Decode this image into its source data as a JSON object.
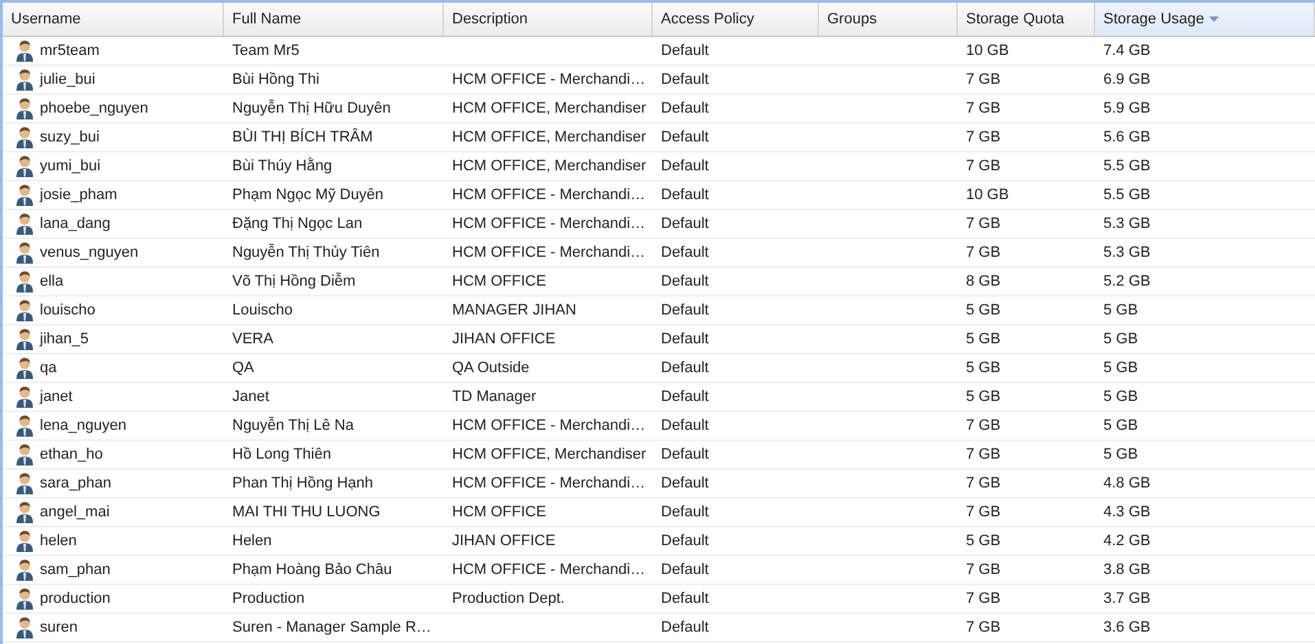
{
  "table": {
    "columns": [
      {
        "label": "Username",
        "sorted": false
      },
      {
        "label": "Full Name",
        "sorted": false
      },
      {
        "label": "Description",
        "sorted": false
      },
      {
        "label": "Access Policy",
        "sorted": false
      },
      {
        "label": "Groups",
        "sorted": false
      },
      {
        "label": "Storage Quota",
        "sorted": false
      },
      {
        "label": "Storage Usage",
        "sorted": true
      }
    ],
    "rows": [
      {
        "username": "mr5team",
        "full_name": "Team Mr5",
        "description": "",
        "access_policy": "Default",
        "groups": "",
        "storage_quota": "10 GB",
        "storage_usage": "7.4 GB"
      },
      {
        "username": "julie_bui",
        "full_name": "Bùi Hồng Thi",
        "description": "HCM OFFICE - Merchandi…",
        "access_policy": "Default",
        "groups": "",
        "storage_quota": "7 GB",
        "storage_usage": "6.9 GB"
      },
      {
        "username": "phoebe_nguyen",
        "full_name": "Nguyễn Thị Hữu Duyên",
        "description": "HCM OFFICE, Merchandiser",
        "access_policy": "Default",
        "groups": "",
        "storage_quota": "7 GB",
        "storage_usage": "5.9 GB"
      },
      {
        "username": "suzy_bui",
        "full_name": "BÙI THỊ BÍCH TRÂM",
        "description": "HCM OFFICE, Merchandiser",
        "access_policy": "Default",
        "groups": "",
        "storage_quota": "7 GB",
        "storage_usage": "5.6 GB"
      },
      {
        "username": "yumi_bui",
        "full_name": "Bùi Thúy Hằng",
        "description": "HCM OFFICE, Merchandiser",
        "access_policy": "Default",
        "groups": "",
        "storage_quota": "7 GB",
        "storage_usage": "5.5 GB"
      },
      {
        "username": "josie_pham",
        "full_name": "Phạm Ngọc Mỹ Duyên",
        "description": "HCM OFFICE - Merchandi…",
        "access_policy": "Default",
        "groups": "",
        "storage_quota": "10 GB",
        "storage_usage": "5.5 GB"
      },
      {
        "username": "lana_dang",
        "full_name": "Đặng Thị Ngọc Lan",
        "description": "HCM OFFICE - Merchandi…",
        "access_policy": "Default",
        "groups": "",
        "storage_quota": "7 GB",
        "storage_usage": "5.3 GB"
      },
      {
        "username": "venus_nguyen",
        "full_name": "Nguyễn Thị Thủy Tiên",
        "description": "HCM OFFICE - Merchandi…",
        "access_policy": "Default",
        "groups": "",
        "storage_quota": "7 GB",
        "storage_usage": "5.3 GB"
      },
      {
        "username": "ella",
        "full_name": "Võ Thị Hồng Diễm",
        "description": "HCM OFFICE",
        "access_policy": "Default",
        "groups": "",
        "storage_quota": "8 GB",
        "storage_usage": "5.2 GB"
      },
      {
        "username": "louischo",
        "full_name": "Louischo",
        "description": "MANAGER JIHAN",
        "access_policy": "Default",
        "groups": "",
        "storage_quota": "5 GB",
        "storage_usage": "5 GB"
      },
      {
        "username": "jihan_5",
        "full_name": "VERA",
        "description": "JIHAN OFFICE",
        "access_policy": "Default",
        "groups": "",
        "storage_quota": "5 GB",
        "storage_usage": "5 GB"
      },
      {
        "username": "qa",
        "full_name": "QA",
        "description": "QA Outside",
        "access_policy": "Default",
        "groups": "",
        "storage_quota": "5 GB",
        "storage_usage": "5 GB"
      },
      {
        "username": "janet",
        "full_name": "Janet",
        "description": "TD Manager",
        "access_policy": "Default",
        "groups": "",
        "storage_quota": "5 GB",
        "storage_usage": "5 GB"
      },
      {
        "username": "lena_nguyen",
        "full_name": "Nguyễn Thị Lê Na",
        "description": "HCM OFFICE - Merchandi…",
        "access_policy": "Default",
        "groups": "",
        "storage_quota": "7 GB",
        "storage_usage": "5 GB"
      },
      {
        "username": "ethan_ho",
        "full_name": "Hồ Long Thiên",
        "description": "HCM OFFICE, Merchandiser",
        "access_policy": "Default",
        "groups": "",
        "storage_quota": "7 GB",
        "storage_usage": "5 GB"
      },
      {
        "username": "sara_phan",
        "full_name": "Phan Thị Hồng Hạnh",
        "description": "HCM OFFICE - Merchandi…",
        "access_policy": "Default",
        "groups": "",
        "storage_quota": "7 GB",
        "storage_usage": "4.8 GB"
      },
      {
        "username": "angel_mai",
        "full_name": "MAI THI THU LUONG",
        "description": "HCM OFFICE",
        "access_policy": "Default",
        "groups": "",
        "storage_quota": "7 GB",
        "storage_usage": "4.3 GB"
      },
      {
        "username": "helen",
        "full_name": "Helen",
        "description": "JIHAN OFFICE",
        "access_policy": "Default",
        "groups": "",
        "storage_quota": "5 GB",
        "storage_usage": "4.2 GB"
      },
      {
        "username": "sam_phan",
        "full_name": "Phạm Hoàng Bảo Châu",
        "description": "HCM OFFICE - Merchandi…",
        "access_policy": "Default",
        "groups": "",
        "storage_quota": "7 GB",
        "storage_usage": "3.8 GB"
      },
      {
        "username": "production",
        "full_name": "Production",
        "description": "Production Dept.",
        "access_policy": "Default",
        "groups": "",
        "storage_quota": "7 GB",
        "storage_usage": "3.7 GB"
      },
      {
        "username": "suren",
        "full_name": "Suren - Manager Sample R…",
        "description": "",
        "access_policy": "Default",
        "groups": "",
        "storage_quota": "7 GB",
        "storage_usage": "3.6 GB"
      }
    ]
  }
}
